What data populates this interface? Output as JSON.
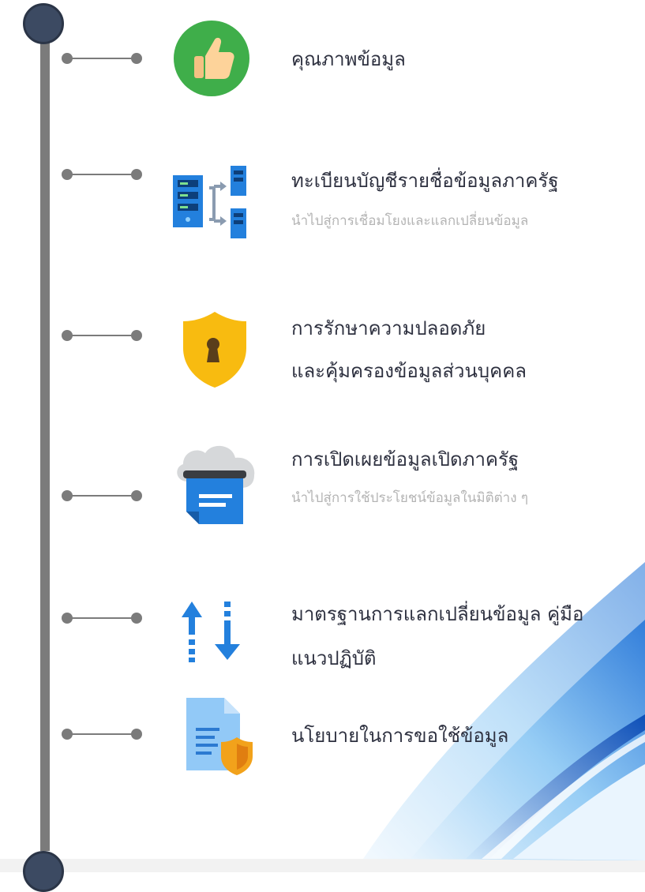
{
  "timeline": {
    "items": [
      {
        "icon": "thumbs-up-icon",
        "title": "คุณภาพข้อมูล",
        "title2": "",
        "subtitle": ""
      },
      {
        "icon": "servers-icon",
        "title": "ทะเบียนบัญชีรายชื่อข้อมูลภาครัฐ",
        "title2": "",
        "subtitle": "นำไปสู่การเชื่อมโยงและแลกเปลี่ยนข้อมูล"
      },
      {
        "icon": "shield-lock-icon",
        "title": "การรักษาความปลอดภัย",
        "title2": "และคุ้มครองข้อมูลส่วนบุคคล",
        "subtitle": ""
      },
      {
        "icon": "cloud-print-icon",
        "title": "การเปิดเผยข้อมูลเปิดภาครัฐ",
        "title2": "",
        "subtitle": "นำไปสู่การใช้ประโยชน์ข้อมูลในมิติต่าง ๆ"
      },
      {
        "icon": "exchange-arrows-icon",
        "title": "มาตรฐานการแลกเปลี่ยนข้อมูล คู่มือ",
        "title2": "แนวปฏิบัติ",
        "subtitle": ""
      },
      {
        "icon": "document-shield-icon",
        "title": "นโยบายในการขอใช้ข้อมูล",
        "title2": "",
        "subtitle": ""
      }
    ]
  },
  "colors": {
    "timeline": "#7b7b7b",
    "cap": "#3c4a62",
    "title": "#2e3140",
    "subtitle": "#b4b4b4",
    "accent_blue": "#2f86e8"
  }
}
